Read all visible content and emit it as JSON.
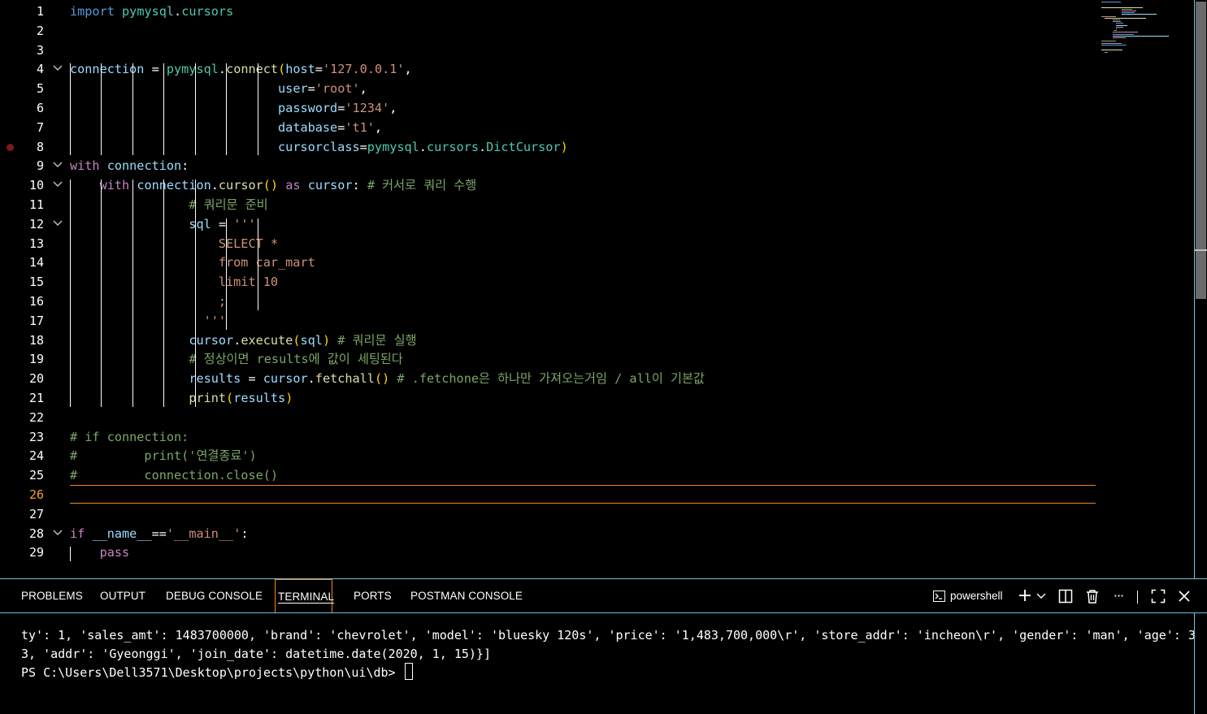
{
  "editor": {
    "active_line": 26,
    "breakpoint_line": 8,
    "fold_lines": [
      4,
      9,
      10,
      12,
      28
    ],
    "lines": [
      {
        "n": 1,
        "tokens": [
          [
            "kw",
            "import"
          ],
          [
            "op",
            " "
          ],
          [
            "mod",
            "pymysql"
          ],
          [
            "op",
            "."
          ],
          [
            "mod",
            "cursors"
          ]
        ]
      },
      {
        "n": 2,
        "tokens": []
      },
      {
        "n": 3,
        "tokens": []
      },
      {
        "n": 4,
        "tokens": [
          [
            "var",
            "connection"
          ],
          [
            "op",
            " = "
          ],
          [
            "mod",
            "pymysql"
          ],
          [
            "op",
            "."
          ],
          [
            "fn",
            "connect"
          ],
          [
            "par1",
            "("
          ],
          [
            "var",
            "host"
          ],
          [
            "op",
            "="
          ],
          [
            "str",
            "'127.0.0.1'"
          ],
          [
            "op",
            ","
          ]
        ]
      },
      {
        "n": 5,
        "indent": "                            ",
        "tokens": [
          [
            "var",
            "user"
          ],
          [
            "op",
            "="
          ],
          [
            "str",
            "'root'"
          ],
          [
            "op",
            ","
          ]
        ]
      },
      {
        "n": 6,
        "indent": "                            ",
        "tokens": [
          [
            "var",
            "password"
          ],
          [
            "op",
            "="
          ],
          [
            "str",
            "'1234'"
          ],
          [
            "op",
            ","
          ]
        ]
      },
      {
        "n": 7,
        "indent": "                            ",
        "tokens": [
          [
            "var",
            "database"
          ],
          [
            "op",
            "="
          ],
          [
            "str",
            "'t1'"
          ],
          [
            "op",
            ","
          ]
        ]
      },
      {
        "n": 8,
        "indent": "                            ",
        "tokens": [
          [
            "var",
            "cursorclass"
          ],
          [
            "op",
            "="
          ],
          [
            "mod",
            "pymysql"
          ],
          [
            "op",
            "."
          ],
          [
            "mod",
            "cursors"
          ],
          [
            "op",
            "."
          ],
          [
            "mod",
            "DictCursor"
          ],
          [
            "par1",
            ")"
          ]
        ]
      },
      {
        "n": 9,
        "tokens": [
          [
            "ctrl",
            "with"
          ],
          [
            "op",
            " "
          ],
          [
            "var",
            "connection"
          ],
          [
            "op",
            ":"
          ]
        ]
      },
      {
        "n": 10,
        "indent": "    ",
        "tokens": [
          [
            "ctrl",
            "with"
          ],
          [
            "op",
            " "
          ],
          [
            "var",
            "connection"
          ],
          [
            "op",
            "."
          ],
          [
            "fn",
            "cursor"
          ],
          [
            "par1",
            "()"
          ],
          [
            "op",
            " "
          ],
          [
            "ctrl",
            "as"
          ],
          [
            "op",
            " "
          ],
          [
            "var",
            "cursor"
          ],
          [
            "op",
            ": "
          ],
          [
            "cm",
            "# 커서로 쿼리 수행"
          ]
        ]
      },
      {
        "n": 11,
        "indent": "                ",
        "tokens": [
          [
            "cm",
            "# 쿼리문 준비"
          ]
        ]
      },
      {
        "n": 12,
        "indent": "                ",
        "tokens": [
          [
            "var",
            "sql"
          ],
          [
            "op",
            " = "
          ],
          [
            "str",
            "'''"
          ]
        ]
      },
      {
        "n": 13,
        "indent": "                    ",
        "tokens": [
          [
            "str",
            "SELECT *"
          ]
        ]
      },
      {
        "n": 14,
        "indent": "                    ",
        "tokens": [
          [
            "str",
            "from car_mart"
          ]
        ]
      },
      {
        "n": 15,
        "indent": "                    ",
        "tokens": [
          [
            "str",
            "limit 10"
          ]
        ]
      },
      {
        "n": 16,
        "indent": "                    ",
        "tokens": [
          [
            "str",
            ";"
          ]
        ]
      },
      {
        "n": 17,
        "indent": "                  ",
        "tokens": [
          [
            "str",
            "'''"
          ]
        ]
      },
      {
        "n": 18,
        "indent": "                ",
        "tokens": [
          [
            "var",
            "cursor"
          ],
          [
            "op",
            "."
          ],
          [
            "fn",
            "execute"
          ],
          [
            "par1",
            "("
          ],
          [
            "var",
            "sql"
          ],
          [
            "par1",
            ")"
          ],
          [
            "op",
            " "
          ],
          [
            "cm",
            "# 쿼리문 실행"
          ]
        ]
      },
      {
        "n": 19,
        "indent": "                ",
        "tokens": [
          [
            "cm",
            "# 정상이면 results에 값이 세팅된다"
          ]
        ]
      },
      {
        "n": 20,
        "indent": "                ",
        "tokens": [
          [
            "var",
            "results"
          ],
          [
            "op",
            " = "
          ],
          [
            "var",
            "cursor"
          ],
          [
            "op",
            "."
          ],
          [
            "fn",
            "fetchall"
          ],
          [
            "par1",
            "()"
          ],
          [
            "op",
            " "
          ],
          [
            "cm",
            "# .fetchone은 하나만 가져오는거임 / all이 기본값"
          ]
        ]
      },
      {
        "n": 21,
        "indent": "                ",
        "tokens": [
          [
            "fn",
            "print"
          ],
          [
            "par1",
            "("
          ],
          [
            "var",
            "results"
          ],
          [
            "par1",
            ")"
          ]
        ]
      },
      {
        "n": 22,
        "tokens": []
      },
      {
        "n": 23,
        "tokens": [
          [
            "cm",
            "# if connection:"
          ]
        ]
      },
      {
        "n": 24,
        "tokens": [
          [
            "cm",
            "#         print('연결종료')"
          ]
        ]
      },
      {
        "n": 25,
        "tokens": [
          [
            "cm",
            "#         connection.close()"
          ]
        ]
      },
      {
        "n": 26,
        "tokens": []
      },
      {
        "n": 27,
        "tokens": []
      },
      {
        "n": 28,
        "tokens": [
          [
            "ctrl",
            "if"
          ],
          [
            "op",
            " "
          ],
          [
            "var",
            "__name__"
          ],
          [
            "op",
            "=="
          ],
          [
            "str",
            "'__main__'"
          ],
          [
            "op",
            ":"
          ]
        ]
      },
      {
        "n": 29,
        "indent": "    ",
        "tokens": [
          [
            "ctrl",
            "pass"
          ]
        ]
      }
    ]
  },
  "panel": {
    "tabs": [
      {
        "id": "problems",
        "label": "PROBLEMS",
        "active": false
      },
      {
        "id": "output",
        "label": "OUTPUT",
        "active": false
      },
      {
        "id": "debug-console",
        "label": "DEBUG CONSOLE",
        "active": false
      },
      {
        "id": "terminal",
        "label": "TERMINAL",
        "active": true
      },
      {
        "id": "ports",
        "label": "PORTS",
        "active": false
      },
      {
        "id": "postman-console",
        "label": "POSTMAN CONSOLE",
        "active": false
      }
    ],
    "shell_label": "powershell",
    "actions": {
      "new_terminal": "+",
      "dropdown": "⌄",
      "split": "◫",
      "trash": "🗑",
      "more": "···",
      "maximize": "⛶",
      "close": "✕"
    }
  },
  "terminal": {
    "lines": [
      "ty': 1, 'sales_amt': 1483700000, 'brand': 'chevrolet', 'model': 'bluesky 120s', 'price': '1,483,700,000\\r', 'store_addr': 'incheon\\r', 'gender': 'man', 'age': 3",
      "3, 'addr': 'Gyeonggi', 'join_date': datetime.date(2020, 1, 15)}]",
      "PS C:\\Users\\Dell3571\\Desktop\\projects\\python\\ui\\db> "
    ]
  },
  "colors": {
    "background": "#000000",
    "panel_border": "#6fc3df",
    "active_border": "#f38518",
    "keyword": "#569cd6",
    "control": "#c586c0",
    "function": "#dcdcaa",
    "module": "#4ec9b0",
    "variable": "#9cdcfe",
    "string": "#ce9178",
    "comment": "#7ca668"
  }
}
